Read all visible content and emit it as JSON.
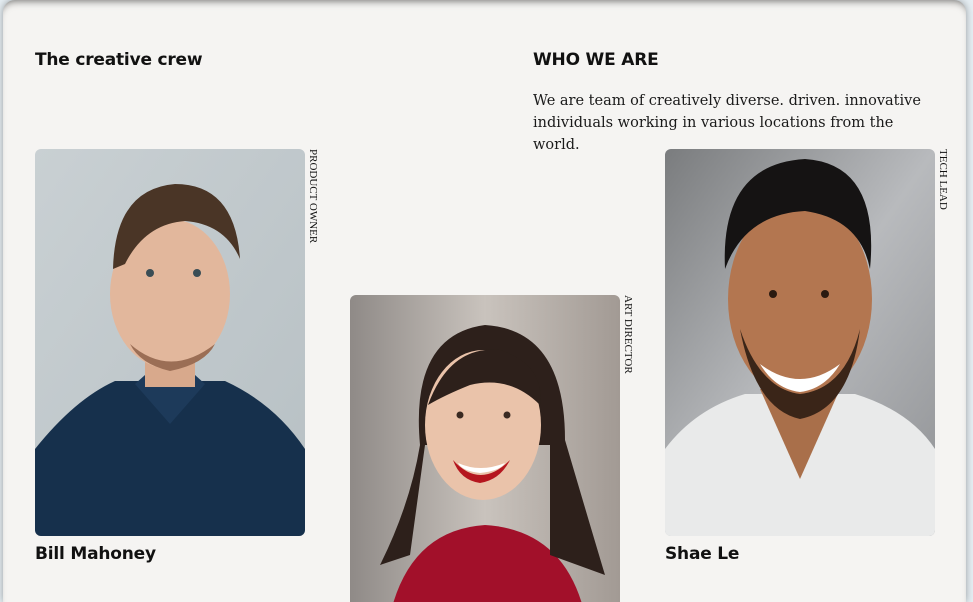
{
  "team_section": {
    "title": "The creative crew"
  },
  "about": {
    "title": "WHO WE ARE",
    "text": "We are team of creatively diverse. driven. innovative individuals working in various locations from the world."
  },
  "members": [
    {
      "name": "Bill Mahoney",
      "role": "PRODUCT OWNER",
      "photo": "portrait-man-navy-polo"
    },
    {
      "name": "",
      "role": "ART DIRECTOR",
      "photo": "portrait-woman-red-top"
    },
    {
      "name": "Shae Le",
      "role": "TECH LEAD",
      "photo": "portrait-man-white-tee"
    }
  ]
}
